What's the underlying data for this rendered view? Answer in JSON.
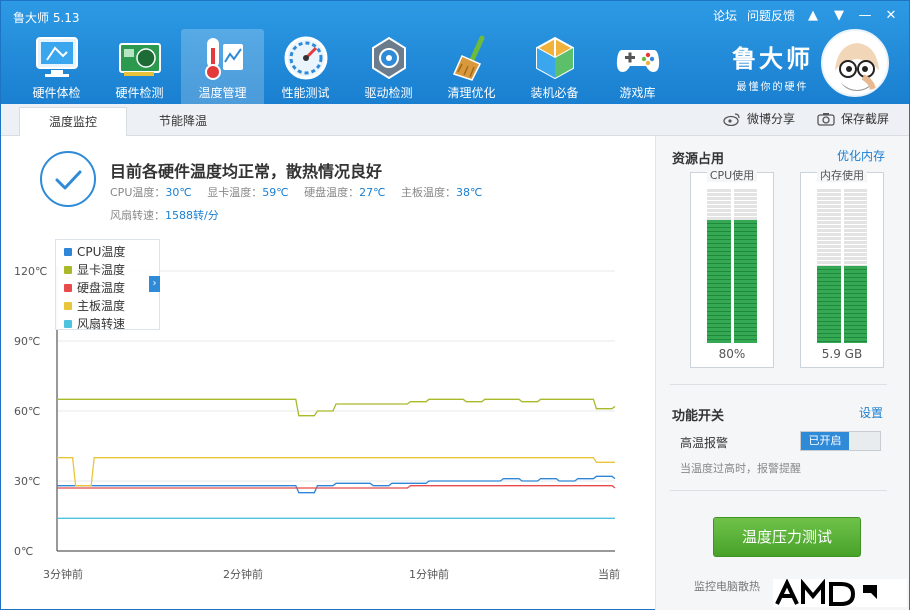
{
  "app": {
    "title": "鲁大师 5.13",
    "links": [
      "论坛",
      "问题反馈"
    ]
  },
  "nav": [
    {
      "label": "硬件体检",
      "icon": "monitor-icon"
    },
    {
      "label": "硬件检测",
      "icon": "graphics-card-icon"
    },
    {
      "label": "温度管理",
      "icon": "thermometer-icon",
      "active": true
    },
    {
      "label": "性能测试",
      "icon": "speedometer-icon"
    },
    {
      "label": "驱动检测",
      "icon": "gear-box-icon"
    },
    {
      "label": "清理优化",
      "icon": "broom-icon"
    },
    {
      "label": "装机必备",
      "icon": "cube-icon"
    },
    {
      "label": "游戏库",
      "icon": "gamepad-icon"
    }
  ],
  "brand": {
    "name": "鲁大师",
    "slogan": "最懂你的硬件"
  },
  "tabs": [
    {
      "label": "温度监控",
      "active": true
    },
    {
      "label": "节能降温"
    }
  ],
  "subbar": {
    "share": "微博分享",
    "screenshot": "保存截屏"
  },
  "status": {
    "title": "目前各硬件温度均正常，散热情况良好",
    "cpu_label": "CPU温度：",
    "cpu_value": "30℃",
    "gpu_label": "显卡温度：",
    "gpu_value": "59℃",
    "disk_label": "硬盘温度：",
    "disk_value": "27℃",
    "board_label": "主板温度：",
    "board_value": "38℃",
    "fan_label": "风扇转速：",
    "fan_value": "1588转/分"
  },
  "legend": [
    {
      "name": "CPU温度",
      "color": "#2f86d8"
    },
    {
      "name": "显卡温度",
      "color": "#a9b92a"
    },
    {
      "name": "硬盘温度",
      "color": "#e84b4b"
    },
    {
      "name": "主板温度",
      "color": "#e9c53b"
    },
    {
      "name": "风扇转速",
      "color": "#4ec3e0"
    }
  ],
  "chart_data": {
    "type": "line",
    "y_ticks": [
      "0℃",
      "30℃",
      "60℃",
      "90℃",
      "120℃"
    ],
    "x_ticks": [
      "3分钟前",
      "2分钟前",
      "1分钟前",
      "当前"
    ],
    "ylim": [
      0,
      120
    ],
    "x": [
      0,
      6,
      12,
      18,
      24,
      30,
      36,
      42,
      48,
      54,
      60,
      66,
      72,
      78,
      84,
      90,
      96,
      102,
      108,
      114,
      120,
      126,
      132,
      138,
      144,
      150,
      156,
      162,
      168,
      174,
      180
    ],
    "series": [
      {
        "name": "CPU温度",
        "values": [
          28,
          28,
          28,
          28,
          28,
          28,
          28,
          28,
          28,
          28,
          28,
          28,
          28,
          25,
          28,
          29,
          29,
          28,
          29,
          29,
          30,
          30,
          30,
          30,
          31,
          30,
          31,
          30,
          31,
          32,
          31
        ]
      },
      {
        "name": "显卡温度",
        "values": [
          65,
          65,
          65,
          65,
          65,
          65,
          65,
          65,
          65,
          65,
          65,
          65,
          65,
          58,
          60,
          63,
          63,
          63,
          63,
          64,
          65,
          65,
          64,
          65,
          65,
          64,
          65,
          65,
          65,
          61,
          62
        ]
      },
      {
        "name": "硬盘温度",
        "values": [
          27,
          27,
          27,
          27,
          27,
          27,
          27,
          27,
          27,
          27,
          27,
          27,
          27,
          27,
          27,
          27,
          27,
          27,
          27,
          28,
          28,
          28,
          28,
          28,
          28,
          28,
          28,
          28,
          28,
          28,
          27
        ]
      },
      {
        "name": "主板温度",
        "values": [
          40,
          28,
          40,
          40,
          40,
          40,
          40,
          40,
          40,
          40,
          40,
          40,
          40,
          40,
          40,
          40,
          40,
          40,
          40,
          40,
          40,
          40,
          40,
          40,
          40,
          40,
          40,
          40,
          40,
          38,
          38
        ]
      },
      {
        "name": "风扇转速",
        "values": [
          14,
          14,
          14,
          14,
          14,
          14,
          14,
          14,
          14,
          14,
          14,
          14,
          14,
          14,
          14,
          14,
          14,
          14,
          14,
          14,
          14,
          14,
          14,
          14,
          14,
          14,
          14,
          14,
          14,
          14,
          14
        ]
      }
    ]
  },
  "resources": {
    "title": "资源占用",
    "link": "优化内存",
    "cpu": {
      "label": "CPU使用",
      "value": "80%",
      "fill": 0.8
    },
    "memory": {
      "label": "内存使用",
      "value": "5.9 GB",
      "fill": 0.5
    }
  },
  "functions": {
    "title": "功能开关",
    "link": "设置",
    "alarm_label": "高温报警",
    "alarm_state": "已开启",
    "alarm_desc": "当温度过高时，报警提醒",
    "test_button": "温度压力测试",
    "monitor_text": "监控电脑散热"
  },
  "watermark": "AMD"
}
